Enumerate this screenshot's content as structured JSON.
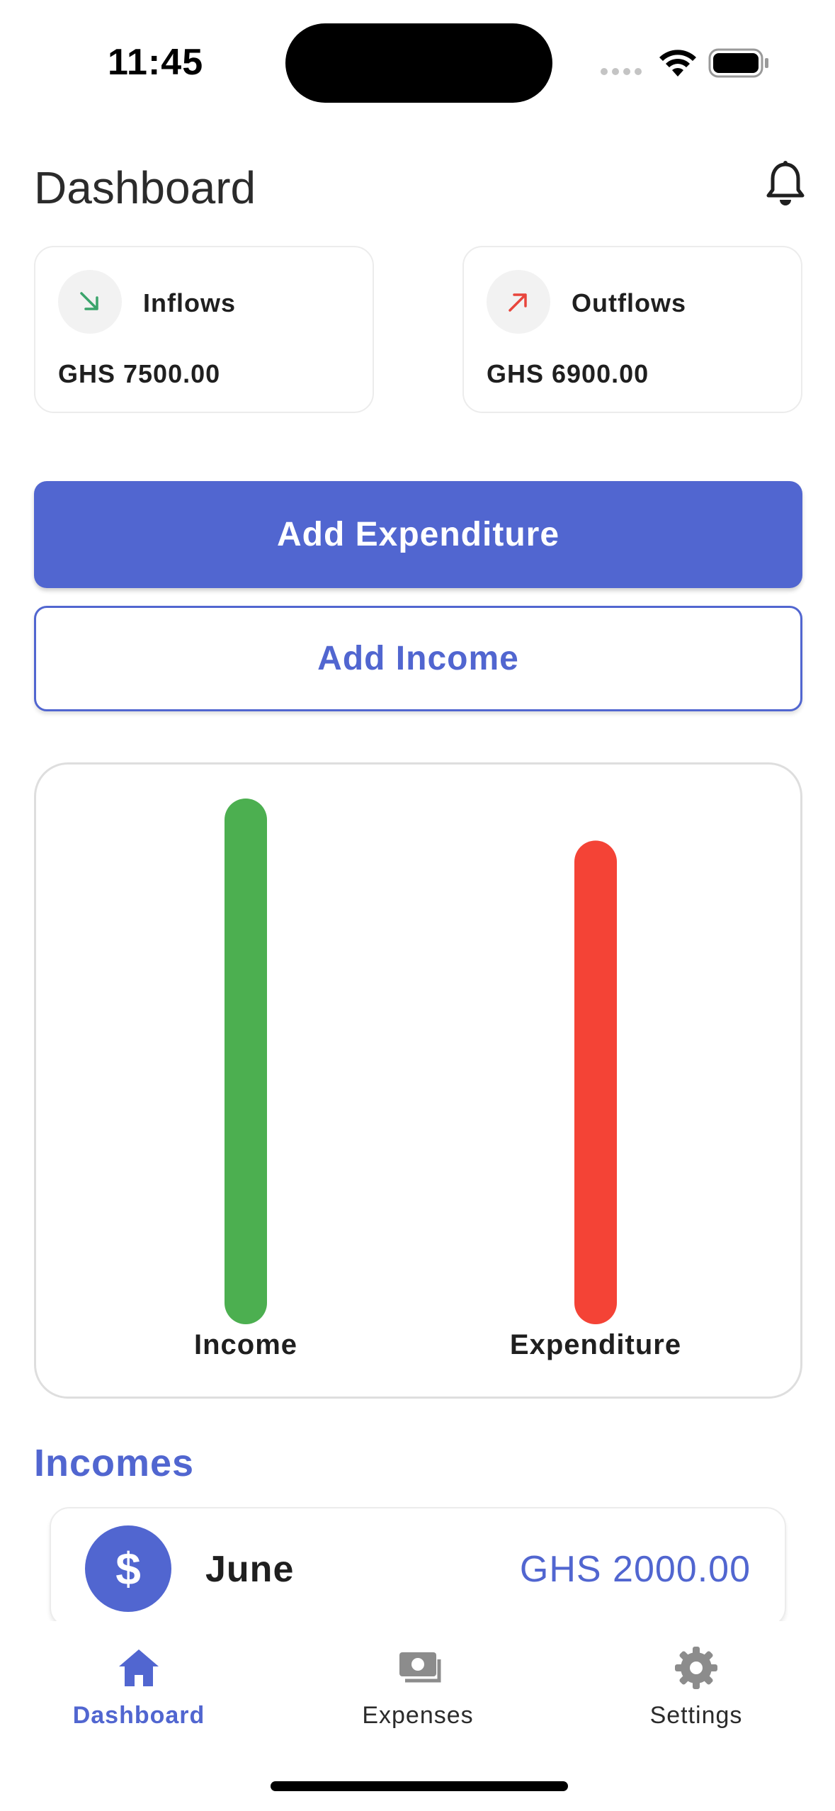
{
  "status_bar": {
    "time": "11:45"
  },
  "header": {
    "title": "Dashboard",
    "notification_icon": "bell-icon"
  },
  "stats": {
    "inflows": {
      "label": "Inflows",
      "value": "GHS 7500.00",
      "icon": "arrow-down-right-icon",
      "color": "#3aa46b"
    },
    "outflows": {
      "label": "Outflows",
      "value": "GHS 6900.00",
      "icon": "arrow-up-right-icon",
      "color": "#e8453c"
    }
  },
  "actions": {
    "add_expenditure": "Add Expenditure",
    "add_income": "Add Income"
  },
  "chart_data": {
    "type": "bar",
    "categories": [
      "Income",
      "Expenditure"
    ],
    "values": [
      7500,
      6900
    ],
    "colors": [
      "#4caf50",
      "#f44336"
    ],
    "title": "",
    "xlabel": "",
    "ylabel": "",
    "ylim": [
      0,
      7500
    ],
    "grid": false
  },
  "incomes": {
    "title": "Incomes",
    "items": [
      {
        "name": "June",
        "amount": "GHS 2000.00",
        "icon": "dollar-icon"
      }
    ]
  },
  "nav": {
    "items": [
      {
        "label": "Dashboard",
        "icon": "home-icon",
        "active": true
      },
      {
        "label": "Expenses",
        "icon": "cash-icon",
        "active": false
      },
      {
        "label": "Settings",
        "icon": "gear-icon",
        "active": false
      }
    ]
  },
  "colors": {
    "accent": "#5166d0",
    "income": "#4caf50",
    "expenditure": "#f44336"
  }
}
